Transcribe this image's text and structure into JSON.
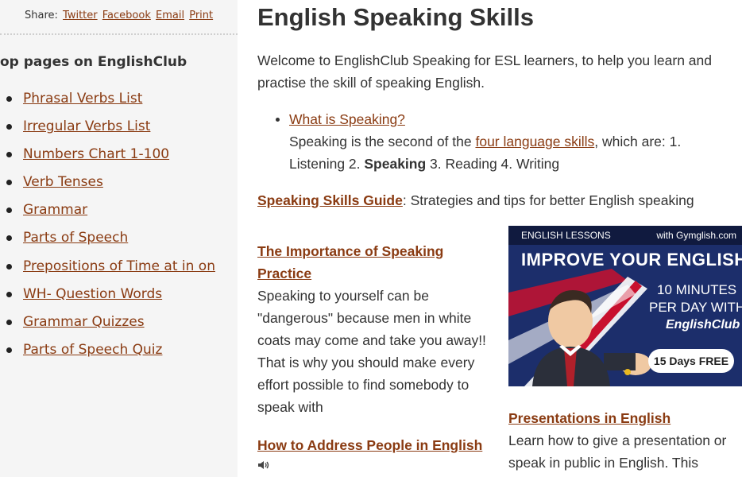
{
  "sidebar": {
    "share": {
      "label": "Share:",
      "links": [
        "Twitter",
        "Facebook",
        "Email",
        "Print"
      ]
    },
    "top_pages_title": "op pages on EnglishClub",
    "top_pages": [
      "Phrasal Verbs List",
      "Irregular Verbs List",
      "Numbers Chart 1-100",
      "Verb Tenses",
      "Grammar",
      "Parts of Speech",
      "Prepositions of Time at in on",
      "WH- Question Words",
      "Grammar Quizzes",
      "Parts of Speech Quiz"
    ]
  },
  "main": {
    "title": "English Speaking Skills",
    "intro": "Welcome to EnglishClub Speaking for ESL learners, to help you learn and practise the skill of speaking English.",
    "what_is": {
      "link": "What is Speaking?",
      "text_before": "Speaking is the second of the ",
      "link2": "four language skills",
      "text_after": ", which are: 1. Listening 2. ",
      "bold": "Speaking",
      "text_end": " 3. Reading 4. Writing"
    },
    "guide": {
      "link": "Speaking Skills Guide",
      "text": ": Strategies and tips for better English speaking"
    },
    "importance": {
      "heading": "The Importance of Speaking Practice",
      "text": "Speaking to yourself can be \"dangerous\" because men in white coats may come and take you away!! That is why you should make every effort possible to find somebody to speak with"
    },
    "address": {
      "heading": "How to Address People in English"
    },
    "presentations": {
      "heading": "Presentations in English",
      "text": "Learn how to give a presentation or speak in public in English. This"
    }
  },
  "ad": {
    "top_left": "ENGLISH LESSONS",
    "top_right": "with Gymglish.com",
    "headline": "IMPROVE YOUR ENGLISH",
    "line1": "10 MINUTES",
    "line2": "PER DAY WITH",
    "brand": "EnglishClub",
    "cta": "15 Days FREE"
  },
  "colors": {
    "link": "#8a3b12",
    "text": "#333333",
    "sidebar_bg": "#f5f5f5",
    "ad_bg": "#1c2e6b"
  }
}
